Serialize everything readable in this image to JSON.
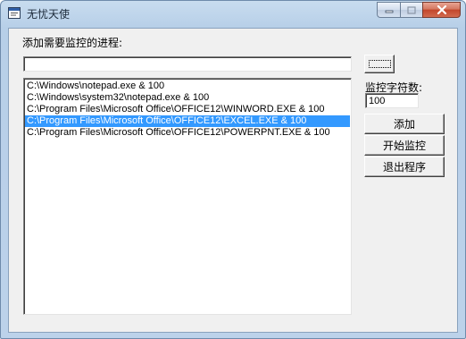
{
  "window": {
    "title": "无忧天使",
    "icon": "app-window-icon"
  },
  "form": {
    "process_label": "添加需要监控的进程:",
    "process_input": {
      "value": "",
      "placeholder": ""
    },
    "char_count_label": "监控字符数:",
    "char_count_input": {
      "value": "100"
    },
    "buttons": {
      "browse": "",
      "add": "添加",
      "start_monitor": "开始监控",
      "exit": "退出程序"
    }
  },
  "process_list": {
    "items": [
      "C:\\Windows\\notepad.exe  &  100",
      "C:\\Windows\\system32\\notepad.exe  &  100",
      "C:\\Program Files\\Microsoft Office\\OFFICE12\\WINWORD.EXE  &  100",
      "C:\\Program Files\\Microsoft Office\\OFFICE12\\EXCEL.EXE  &  100",
      "C:\\Program Files\\Microsoft Office\\OFFICE12\\POWERPNT.EXE  &  100"
    ],
    "selected_index": 3
  },
  "colors": {
    "selection": "#3399ff",
    "close_button": "#c2462b",
    "title_bar": "#b7cfe8"
  }
}
